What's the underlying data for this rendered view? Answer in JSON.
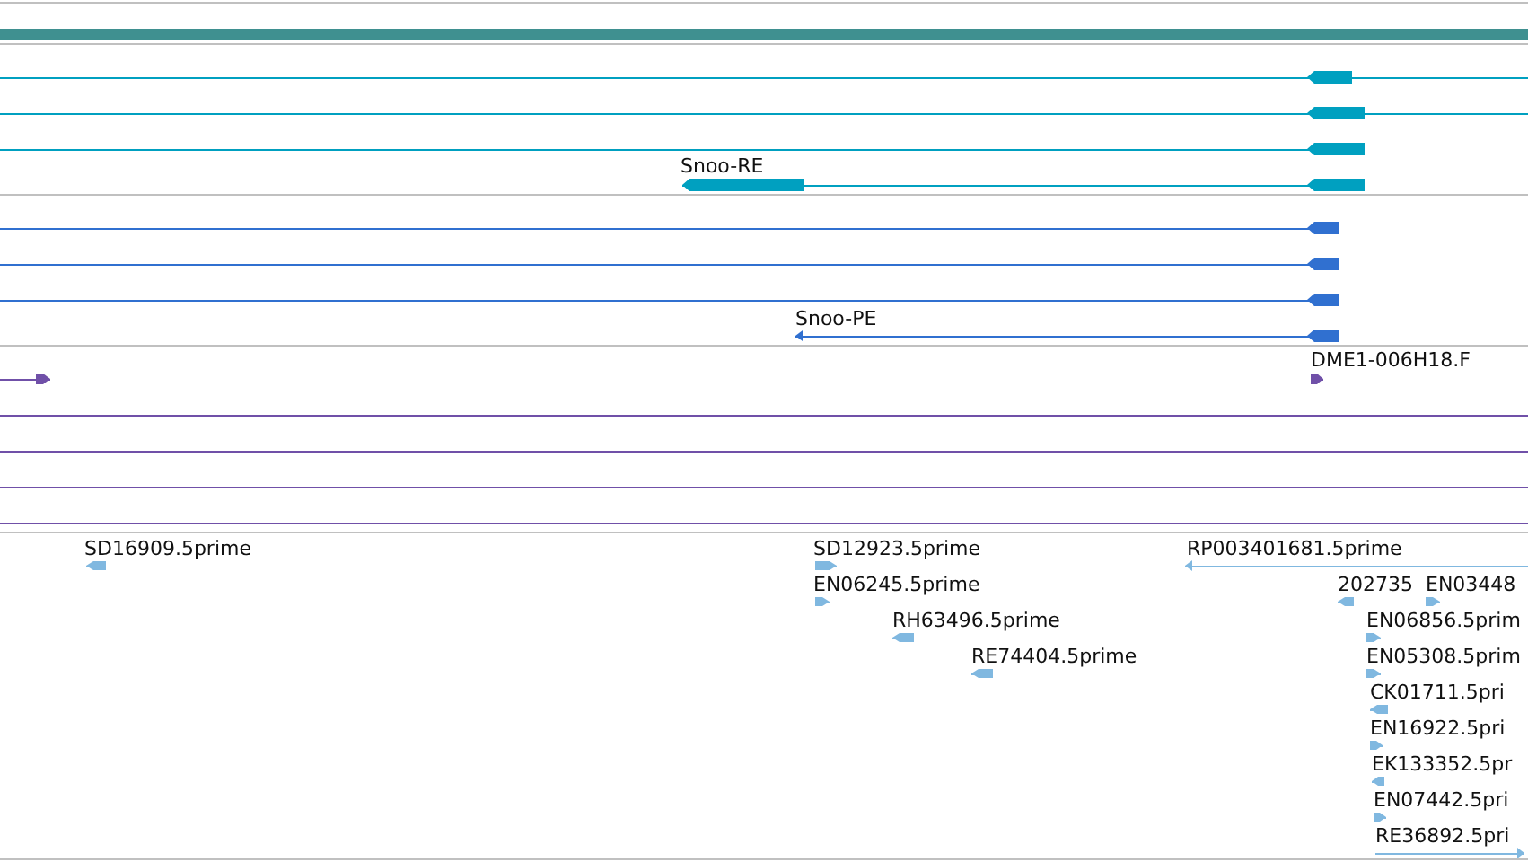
{
  "tracks": [
    {
      "kind": "transcript",
      "color": "#00a0c0",
      "features": [
        {
          "reverse": true
        },
        {
          "reverse": true
        },
        {
          "reverse": true
        },
        {
          "reverse": true,
          "label": "Snoo-RE"
        }
      ]
    },
    {
      "kind": "protein",
      "color": "#3070d0",
      "features": [
        {
          "reverse": true
        },
        {
          "reverse": true
        },
        {
          "reverse": true
        },
        {
          "reverse": true,
          "label": "Snoo-PE"
        }
      ]
    },
    {
      "kind": "clone",
      "color": "#7050a8",
      "features": [
        {
          "reverse": false
        },
        {
          "reverse": false,
          "label": "DME1-006H18.F"
        }
      ]
    },
    {
      "kind": "est",
      "color": "#80b8e0",
      "features": [
        {
          "reverse": true,
          "label": "SD16909.5prime"
        },
        {
          "reverse": false,
          "label": "SD12923.5prime"
        },
        {
          "reverse": true,
          "label": "RP003401681.5prime"
        },
        {
          "reverse": false,
          "label": "EN06245.5prime"
        },
        {
          "reverse": true,
          "label": "202735"
        },
        {
          "reverse": false,
          "label": "EN03448"
        },
        {
          "reverse": true,
          "label": "RH63496.5prime"
        },
        {
          "reverse": false,
          "label": "EN06856.5prim"
        },
        {
          "reverse": true,
          "label": "RE74404.5prime"
        },
        {
          "reverse": false,
          "label": "EN05308.5prim"
        },
        {
          "reverse": true,
          "label": "CK01711.5pri"
        },
        {
          "reverse": false,
          "label": "EN16922.5pri"
        },
        {
          "reverse": true,
          "label": "EK133352.5pr"
        },
        {
          "reverse": false,
          "label": "EN07442.5pri"
        },
        {
          "reverse": false,
          "label": "RE36892.5pri"
        }
      ]
    }
  ]
}
